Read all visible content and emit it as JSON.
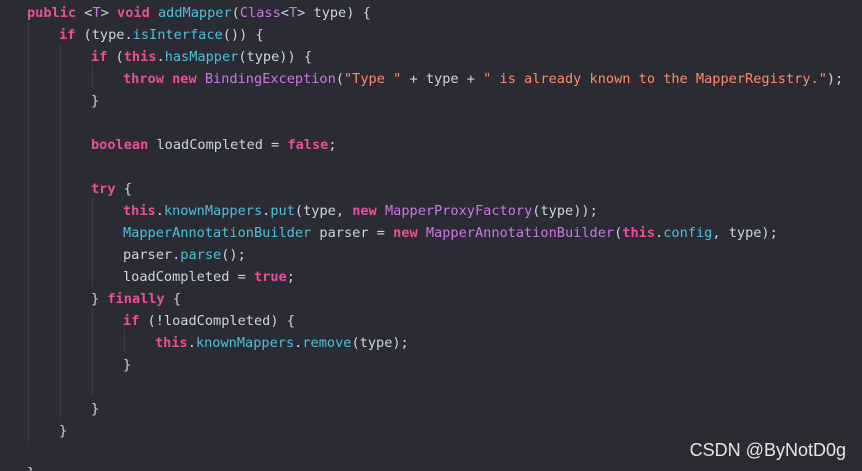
{
  "colors": {
    "background": "#2b2b33",
    "keyword": "#e94f9c",
    "type": "#cd77e6",
    "method": "#4ec0d8",
    "string": "#ff8b6b",
    "plain": "#d0d4dc"
  },
  "code_lines": [
    [
      [
        "kw",
        "public"
      ],
      [
        "pl",
        " <"
      ],
      [
        "ty",
        "T"
      ],
      [
        "pl",
        "> "
      ],
      [
        "kw",
        "void"
      ],
      [
        "pl",
        " "
      ],
      [
        "mt",
        "addMapper"
      ],
      [
        "pl",
        "("
      ],
      [
        "ty",
        "Class"
      ],
      [
        "pl",
        "<"
      ],
      [
        "ty",
        "T"
      ],
      [
        "pl",
        "> type) {"
      ]
    ],
    [
      [
        "kw",
        "if"
      ],
      [
        "pl",
        " (type."
      ],
      [
        "mt",
        "isInterface"
      ],
      [
        "pl",
        "()) {"
      ]
    ],
    [
      [
        "kw",
        "if"
      ],
      [
        "pl",
        " ("
      ],
      [
        "kw",
        "this"
      ],
      [
        "pl",
        "."
      ],
      [
        "mt",
        "hasMapper"
      ],
      [
        "pl",
        "(type)) {"
      ]
    ],
    [
      [
        "kw",
        "throw"
      ],
      [
        "pl",
        " "
      ],
      [
        "kw",
        "new"
      ],
      [
        "pl",
        " "
      ],
      [
        "ty",
        "BindingException"
      ],
      [
        "pl",
        "("
      ],
      [
        "st",
        "\"Type \""
      ],
      [
        "pl",
        " + type + "
      ],
      [
        "st",
        "\" is already known to the MapperRegistry.\""
      ],
      [
        "pl",
        ");"
      ]
    ],
    [
      [
        "pl",
        "}"
      ]
    ],
    [],
    [
      [
        "kw",
        "boolean"
      ],
      [
        "pl",
        " loadCompleted = "
      ],
      [
        "kw",
        "false"
      ],
      [
        "pl",
        ";"
      ]
    ],
    [],
    [
      [
        "kw",
        "try"
      ],
      [
        "pl",
        " {"
      ]
    ],
    [
      [
        "kw",
        "this"
      ],
      [
        "pl",
        "."
      ],
      [
        "fd",
        "knownMappers"
      ],
      [
        "pl",
        "."
      ],
      [
        "mt",
        "put"
      ],
      [
        "pl",
        "(type, "
      ],
      [
        "kw",
        "new"
      ],
      [
        "pl",
        " "
      ],
      [
        "ty",
        "MapperProxyFactory"
      ],
      [
        "pl",
        "(type));"
      ]
    ],
    [
      [
        "mt",
        "MapperAnnotationBuilder"
      ],
      [
        "pl",
        " parser = "
      ],
      [
        "kw",
        "new"
      ],
      [
        "pl",
        " "
      ],
      [
        "ty",
        "MapperAnnotationBuilder"
      ],
      [
        "pl",
        "("
      ],
      [
        "kw",
        "this"
      ],
      [
        "pl",
        "."
      ],
      [
        "fd",
        "config"
      ],
      [
        "pl",
        ", type);"
      ]
    ],
    [
      [
        "pl",
        "parser."
      ],
      [
        "mt",
        "parse"
      ],
      [
        "pl",
        "();"
      ]
    ],
    [
      [
        "pl",
        "loadCompleted = "
      ],
      [
        "kw",
        "true"
      ],
      [
        "pl",
        ";"
      ]
    ],
    [
      [
        "pl",
        "} "
      ],
      [
        "kw",
        "finally"
      ],
      [
        "pl",
        " {"
      ]
    ],
    [
      [
        "kw",
        "if"
      ],
      [
        "pl",
        " (!loadCompleted) {"
      ]
    ],
    [
      [
        "kw",
        "this"
      ],
      [
        "pl",
        "."
      ],
      [
        "fd",
        "knownMappers"
      ],
      [
        "pl",
        "."
      ],
      [
        "mt",
        "remove"
      ],
      [
        "pl",
        "(type);"
      ]
    ],
    [
      [
        "pl",
        "}"
      ]
    ],
    [],
    [
      [
        "pl",
        "}"
      ]
    ],
    [
      [
        "pl",
        "}"
      ]
    ],
    [
      [
        "pl",
        "}"
      ]
    ]
  ],
  "watermark": "CSDN @ByNotD0g"
}
